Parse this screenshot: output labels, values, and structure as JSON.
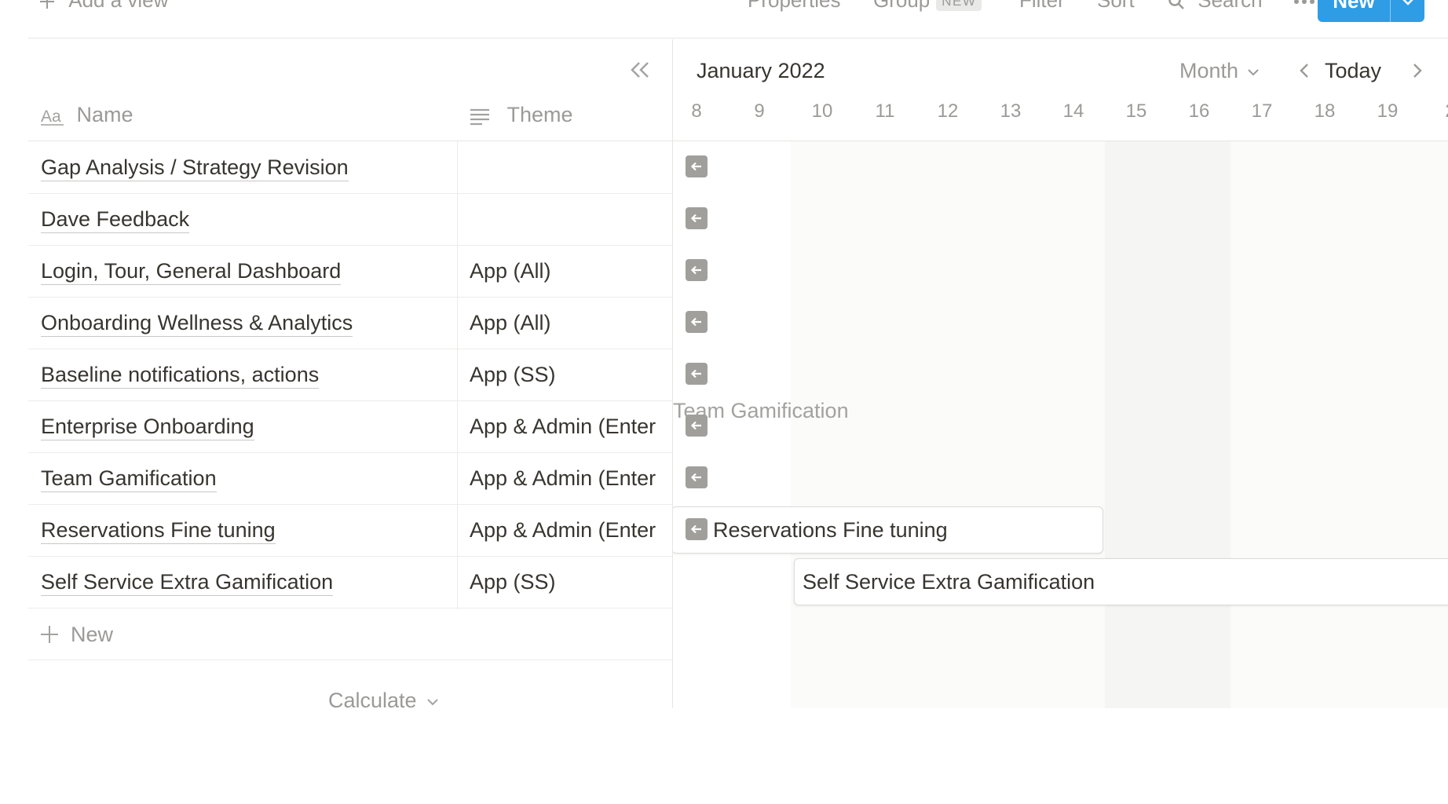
{
  "toolbar": {
    "add_view": "Add a view",
    "properties": "Properties",
    "group": "Group",
    "group_badge": "NEW",
    "filter": "Filter",
    "sort": "Sort",
    "search": "Search",
    "new_button": "New",
    "accent_color": "#2f9ce6"
  },
  "table": {
    "columns": {
      "name": "Name",
      "theme": "Theme"
    },
    "rows": [
      {
        "name": "Gap Analysis / Strategy Revision",
        "theme": ""
      },
      {
        "name": "Dave Feedback",
        "theme": ""
      },
      {
        "name": "Login, Tour, General Dashboard",
        "theme": "App (All)"
      },
      {
        "name": "Onboarding Wellness & Analytics",
        "theme": "App (All)"
      },
      {
        "name": "Baseline notifications, actions",
        "theme": "App (SS)"
      },
      {
        "name": "Enterprise Onboarding",
        "theme": "App & Admin (Enter"
      },
      {
        "name": "Team Gamification",
        "theme": "App & Admin (Enter"
      },
      {
        "name": "Reservations Fine tuning",
        "theme": "App & Admin (Enter"
      },
      {
        "name": "Self Service Extra Gamification",
        "theme": "App (SS)"
      }
    ],
    "new_row": "New",
    "calculate": "Calculate"
  },
  "timeline": {
    "title": "January 2022",
    "scale": "Month",
    "today": "Today",
    "days": [
      "8",
      "9",
      "10",
      "11",
      "12",
      "13",
      "14",
      "15",
      "16",
      "17",
      "18",
      "19",
      "2"
    ],
    "ghost_label": "Team Gamification",
    "bars": {
      "reservations": "Reservations Fine tuning",
      "self_service": "Self Service Extra Gamification"
    }
  }
}
